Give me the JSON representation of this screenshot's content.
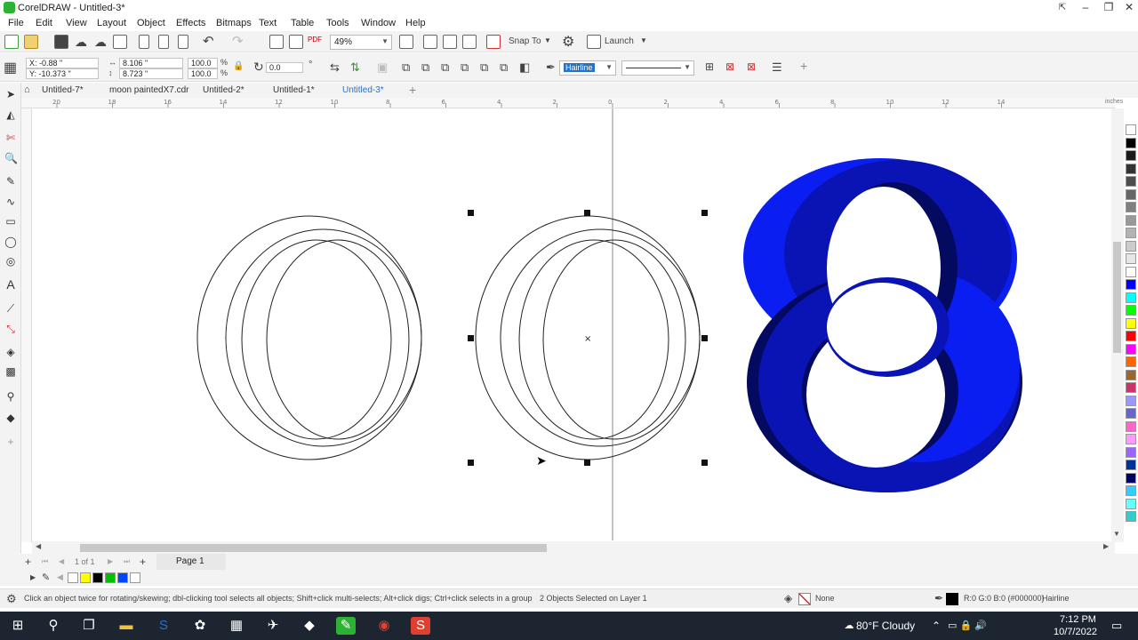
{
  "window": {
    "title": "CorelDRAW - Untitled-3*",
    "controls": [
      "–",
      "❐",
      "✕"
    ]
  },
  "menu": [
    "File",
    "Edit",
    "View",
    "Layout",
    "Object",
    "Effects",
    "Bitmaps",
    "Text",
    "Table",
    "Tools",
    "Window",
    "Help"
  ],
  "toolbar": {
    "zoom": "49%",
    "snap_to": "Snap To",
    "launch": "Launch",
    "pdf": "PDF"
  },
  "propbar": {
    "x": "X: -0.88 \"",
    "y": "Y: -10.373 \"",
    "w": "8.106 \"",
    "h": "8.723 \"",
    "scale_w": "100.0",
    "scale_h": "100.0",
    "pct": "%",
    "angle": "0.0",
    "angle_unit": "°",
    "outline_width": "Hairline"
  },
  "tabs": [
    "Untitled-7*",
    "moon paintedX7.cdr",
    "Untitled-2*",
    "Untitled-1*",
    "Untitled-3*"
  ],
  "ruler": {
    "units": "inches",
    "ticks": [
      "20",
      "18",
      "16",
      "14",
      "12",
      "10",
      "8",
      "6",
      "4",
      "2",
      "0",
      "2",
      "4",
      "6",
      "8",
      "10",
      "12",
      "14"
    ]
  },
  "pages": {
    "counter": "1 of 1",
    "page_tab": "Page 1"
  },
  "status": {
    "hint": "Click an object twice for rotating/skewing; dbl-clicking tool selects all objects; Shift+click multi-selects; Alt+click digs; Ctrl+click selects in a group",
    "selection": "2 Objects Selected on Layer 1",
    "fill": "None",
    "outline_color": "R:0 G:0 B:0 (#000000)",
    "outline": "Hairline"
  },
  "taskbar": {
    "weather": "80°F Cloudy",
    "time": "7:12 PM",
    "date": "10/7/2022"
  },
  "colors": {
    "accent": "#2b70c7",
    "ring_light": "#0a1ef2",
    "ring_mid": "#0a14b4",
    "ring_dark": "#040a60"
  },
  "palette": [
    "#ffffff",
    "#000000",
    "#1a1a1a",
    "#333333",
    "#4d4d4d",
    "#666666",
    "#808080",
    "#999999",
    "#b3b3b3",
    "#cccccc",
    "#e6e6e6",
    "#ffffff",
    "#0000ff",
    "#00ffff",
    "#00ff00",
    "#ffff00",
    "#ff0000",
    "#ff00ff",
    "#ff6600",
    "#996633",
    "#cc3366",
    "#9999ff",
    "#6666cc",
    "#ff66cc",
    "#ff99ff",
    "#9966ff",
    "#003399",
    "#000066",
    "#33ccff",
    "#66ffff",
    "#33cccc"
  ]
}
